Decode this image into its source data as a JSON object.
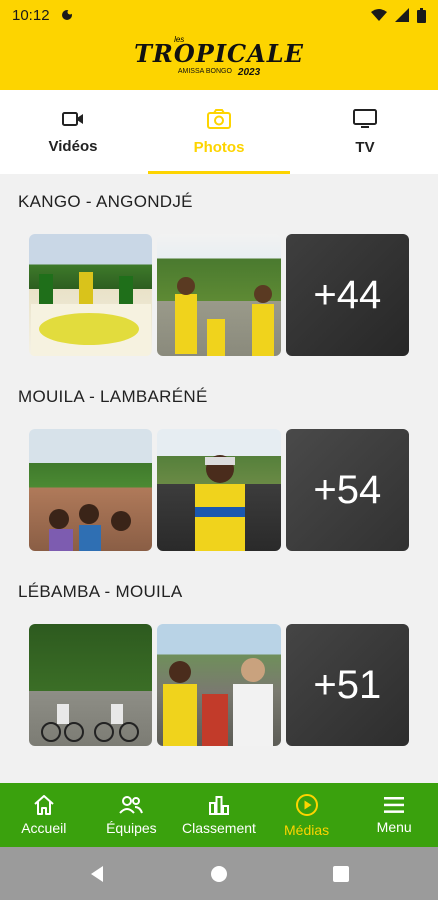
{
  "status": {
    "time": "10:12"
  },
  "header": {
    "logo_les": "les",
    "logo_word": "TROPICALE",
    "logo_sub": "AMISSA BONGO",
    "logo_year": "2023"
  },
  "tabs": [
    {
      "label": "Vidéos",
      "icon": "video-camera-icon"
    },
    {
      "label": "Photos",
      "icon": "camera-icon"
    },
    {
      "label": "TV",
      "icon": "tv-icon"
    }
  ],
  "sections": [
    {
      "title": "KANGO - ANGONDJÉ",
      "more": "+44"
    },
    {
      "title": "MOUILA - LAMBARÉNÉ",
      "more": "+54"
    },
    {
      "title": "LÉBAMBA - MOUILA",
      "more": "+51"
    }
  ],
  "bottom_nav": [
    {
      "label": "Accueil",
      "icon": "home-icon"
    },
    {
      "label": "Équipes",
      "icon": "people-icon"
    },
    {
      "label": "Classement",
      "icon": "bar-chart-icon"
    },
    {
      "label": "Médias",
      "icon": "play-circle-icon"
    },
    {
      "label": "Menu",
      "icon": "hamburger-menu-icon"
    }
  ],
  "colors": {
    "brand_yellow": "#fdd400",
    "nav_green": "#3aa10d"
  }
}
